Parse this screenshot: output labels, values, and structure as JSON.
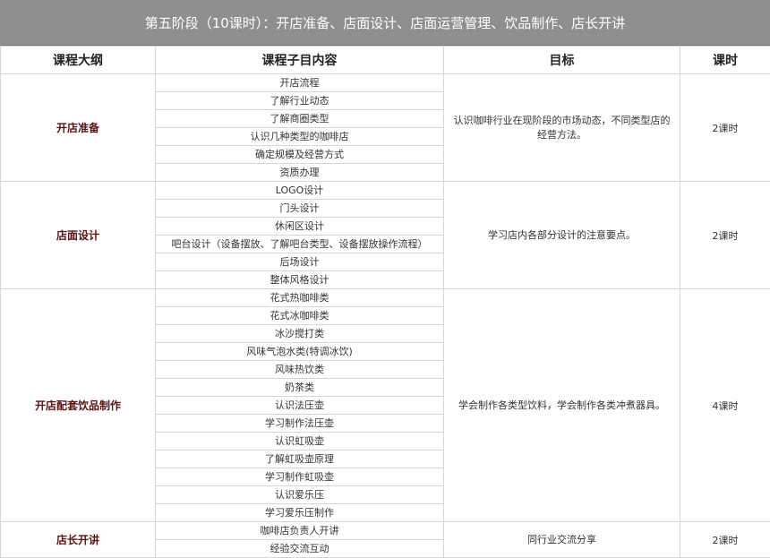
{
  "banner": {
    "title": "第五阶段（10课时）：开店准备、店面设计、店面运营管理、饮品制作、店长开讲"
  },
  "headers": {
    "outline": "课程大纲",
    "content": "课程子目内容",
    "goal": "目标",
    "hours": "课时"
  },
  "sections": [
    {
      "title": "开店准备",
      "items": [
        "开店流程",
        "了解行业动态",
        "了解商圈类型",
        "认识几种类型的咖啡店",
        "确定规模及经营方式",
        "资质办理"
      ],
      "goal": "认识咖啡行业在现阶段的市场动态，不同类型店的经营方法。",
      "hours": "2课时"
    },
    {
      "title": "店面设计",
      "items": [
        "LOGO设计",
        "门头设计",
        "休闲区设计",
        "吧台设计（设备摆放、了解吧台类型、设备摆放操作流程）",
        "后场设计",
        "整体风格设计"
      ],
      "goal": "学习店内各部分设计的注意要点。",
      "hours": "2课时"
    },
    {
      "title": "开店配套饮品制作",
      "items": [
        "花式热咖啡类",
        "花式冰咖啡类",
        "冰沙搅打类",
        "风味气泡水类(特调冰饮)",
        "风味热饮类",
        "奶茶类",
        "认识法压壶",
        "学习制作法压壶",
        "认识虹吸壶",
        "了解虹吸壶原理",
        "学习制作虹吸壶",
        "认识爱乐压",
        "学习爱乐压制作"
      ],
      "goal": "学会制作各类型饮料，学会制作各类冲煮器具。",
      "hours": "4课时"
    },
    {
      "title": "店长开讲",
      "items": [
        "咖啡店负责人开讲",
        "经验交流互动"
      ],
      "goal": "同行业交流分享",
      "hours": "2课时"
    }
  ]
}
